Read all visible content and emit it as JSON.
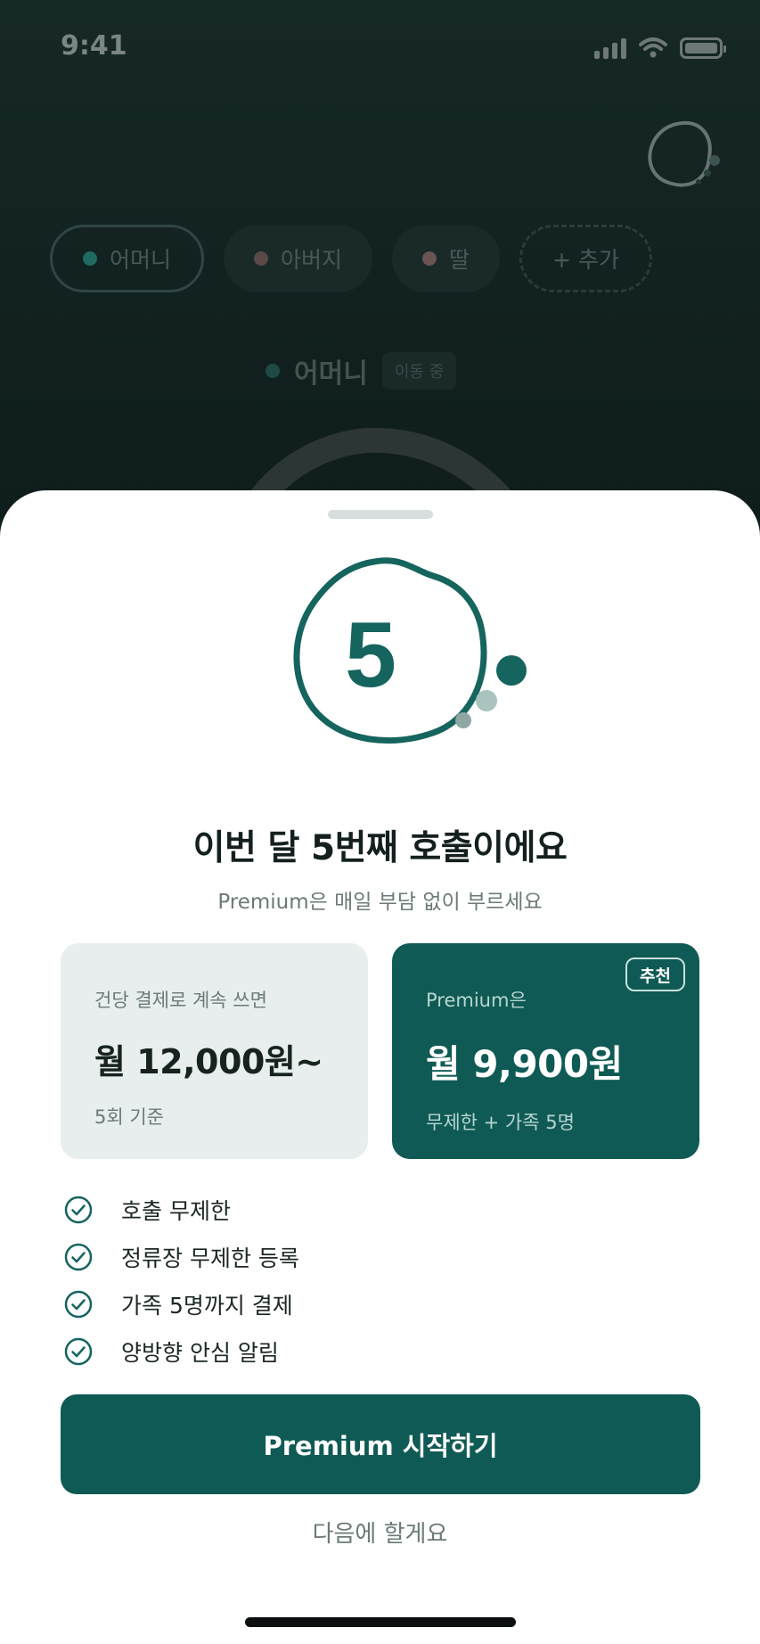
{
  "status_bar": {
    "time": "9:41"
  },
  "background": {
    "family_chips": [
      {
        "label": "어머니",
        "dot_color": "#1f6b62",
        "active": true
      },
      {
        "label": "아버지",
        "dot_color": "#5a4a47",
        "active": false
      },
      {
        "label": "딸",
        "dot_color": "#6a5553",
        "active": false
      }
    ],
    "add_chip_label": "+ 추가",
    "current_member": {
      "name": "어머니",
      "status": "이동 중"
    }
  },
  "sheet": {
    "count_number": "5",
    "title": "이번 달 5번째 호출이에요",
    "subtitle": "Premium은 매일 부담 없이 부르세요",
    "plans": {
      "basic": {
        "label": "건당 결제로 계속 쓰면",
        "price": "월 12,000원~",
        "note": "5회 기준"
      },
      "premium": {
        "badge": "추천",
        "label": "Premium은",
        "price": "월 9,900원",
        "note": "무제한 + 가족 5명"
      }
    },
    "features": [
      "호출 무제한",
      "정류장 무제한 등록",
      "가족 5명까지 결제",
      "양방향 안심 알림"
    ],
    "cta_label": "Premium 시작하기",
    "dismiss_label": "다음에 할게요"
  },
  "colors": {
    "brand_teal": "#0f5a55",
    "sheet_bg": "#ffffff",
    "card_bg": "#e7eeed",
    "dim_bg": "#0c1716"
  }
}
